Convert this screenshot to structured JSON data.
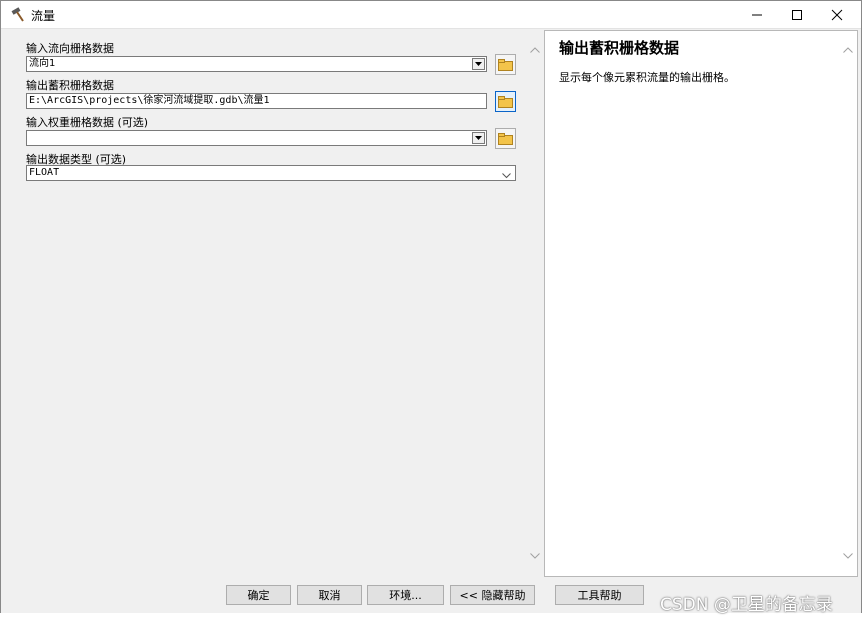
{
  "window": {
    "title": "流量"
  },
  "form": {
    "flow_dir_label": "输入流向栅格数据",
    "flow_dir_value": "流向1",
    "output_label": "输出蓄积栅格数据",
    "output_value": "E:\\ArcGIS\\projects\\徐家河流域提取.gdb\\流量1",
    "weight_label": "输入权重栅格数据 (可选)",
    "weight_value": "",
    "dtype_label": "输出数据类型 (可选)",
    "dtype_value": "FLOAT"
  },
  "help": {
    "title": "输出蓄积栅格数据",
    "text": "显示每个像元累积流量的输出栅格。"
  },
  "buttons": {
    "ok": "确定",
    "cancel": "取消",
    "env": "环境...",
    "hide_help": "<< 隐藏帮助",
    "tool_help": "工具帮助"
  },
  "watermark": "CSDN @卫星的备忘录"
}
